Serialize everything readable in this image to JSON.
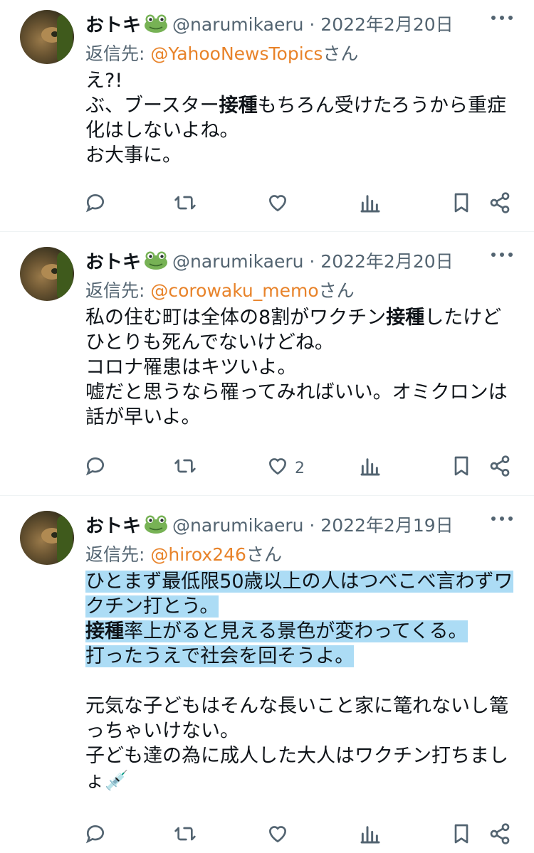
{
  "tweets": [
    {
      "name": "おトキ",
      "handle": "@narumikaeru · 2022年2月20日",
      "reply_prefix": "返信先: ",
      "reply_mention": "@YahooNewsTopics",
      "reply_suffix": "さん",
      "lines": [
        {
          "segments": [
            {
              "text": "え?!",
              "bold": false
            }
          ]
        },
        {
          "segments": [
            {
              "text": "ぶ、ブースター",
              "bold": false
            },
            {
              "text": "接種",
              "bold": true
            },
            {
              "text": "もちろん受けたろうから重症",
              "bold": false
            }
          ]
        },
        {
          "segments": [
            {
              "text": "化はしないよね。",
              "bold": false
            }
          ]
        },
        {
          "segments": [
            {
              "text": "お大事に。",
              "bold": false
            }
          ]
        }
      ],
      "like_count": ""
    },
    {
      "name": "おトキ",
      "handle": "@narumikaeru · 2022年2月20日",
      "reply_prefix": "返信先: ",
      "reply_mention": "@corowaku_memo",
      "reply_suffix": "さん",
      "lines": [
        {
          "segments": [
            {
              "text": "私の住む町は全体の8割がワクチン",
              "bold": false
            },
            {
              "text": "接種",
              "bold": true
            },
            {
              "text": "したけど",
              "bold": false
            }
          ]
        },
        {
          "segments": [
            {
              "text": "ひとりも死んでないけどね。",
              "bold": false
            }
          ]
        },
        {
          "segments": [
            {
              "text": "コロナ罹患はキツいよ。",
              "bold": false
            }
          ]
        },
        {
          "segments": [
            {
              "text": "嘘だと思うなら罹ってみればいい。オミクロンは",
              "bold": false
            }
          ]
        },
        {
          "segments": [
            {
              "text": "話が早いよ。",
              "bold": false
            }
          ]
        }
      ],
      "like_count": "2"
    },
    {
      "name": "おトキ",
      "handle": "@narumikaeru · 2022年2月19日",
      "reply_prefix": "返信先: ",
      "reply_mention": "@hirox246",
      "reply_suffix": "さん",
      "lines": [
        {
          "highlight": true,
          "segments": [
            {
              "text": "ひとまず最低限50歳以上の人はつべこべ言わずワ",
              "bold": false
            }
          ]
        },
        {
          "highlight": true,
          "segments": [
            {
              "text": "クチン打とう。",
              "bold": false
            }
          ]
        },
        {
          "highlight": true,
          "segments": [
            {
              "text": "接種",
              "bold": true
            },
            {
              "text": "率上がると見える景色が変わってくる。",
              "bold": false
            }
          ]
        },
        {
          "highlight": true,
          "segments": [
            {
              "text": "打ったうえで社会を回そうよ。",
              "bold": false
            }
          ]
        },
        {
          "segments": [
            {
              "text": "",
              "bold": false
            }
          ]
        },
        {
          "segments": [
            {
              "text": "元気な子どもはそんな長いこと家に篭れないし篭",
              "bold": false
            }
          ]
        },
        {
          "segments": [
            {
              "text": "っちゃいけない。",
              "bold": false
            }
          ]
        },
        {
          "segments": [
            {
              "text": "子ども達の為に成人した大人はワクチン打ちまし",
              "bold": false
            }
          ]
        },
        {
          "segments": [
            {
              "text": "ょ💉",
              "bold": false
            }
          ]
        }
      ],
      "like_count": ""
    }
  ],
  "colors": {
    "mention": "#e8832a",
    "muted": "#536471",
    "highlight": "#acdcf5"
  },
  "icons": [
    "reply-icon",
    "retweet-icon",
    "like-icon",
    "views-icon",
    "bookmark-icon",
    "share-icon",
    "more-icon",
    "frog-emoji",
    "syringe-emoji"
  ]
}
